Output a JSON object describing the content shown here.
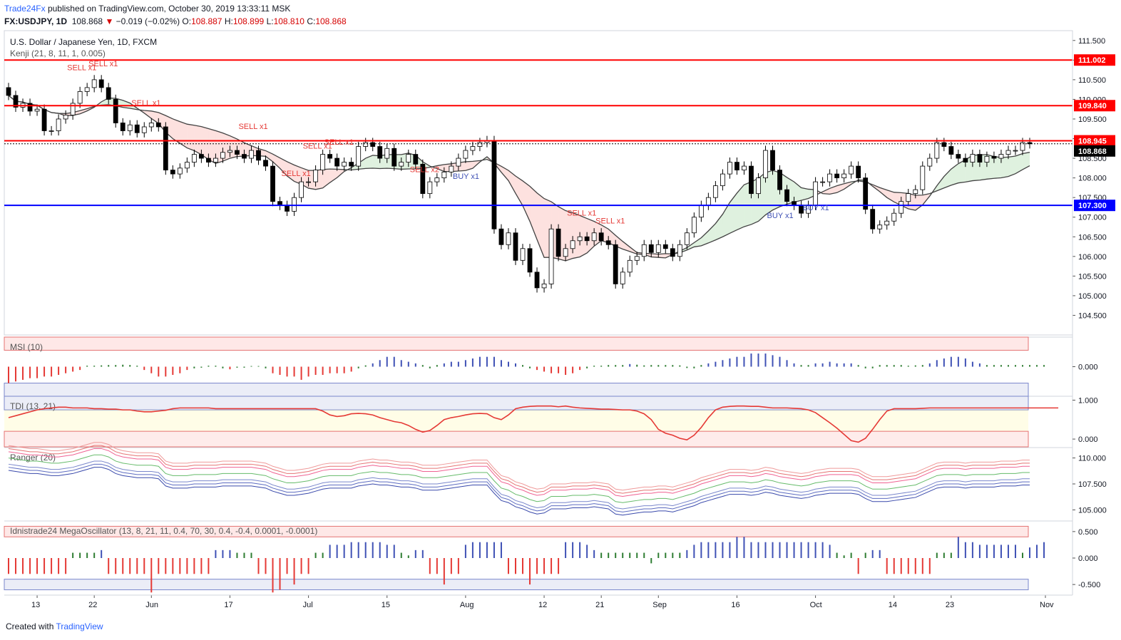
{
  "header": {
    "brand": "Trade24Fx",
    "published": "published on TradingView.com, October 30, 2019 13:33:11 MSK",
    "symbol": "FX:USDJPY, 1D",
    "last": "108.868",
    "change": "−0.019 (−0.02%)",
    "o_label": "O:",
    "o": "108.887",
    "h_label": "H:",
    "h": "108.899",
    "l_label": "L:",
    "l": "108.810",
    "c_label": "C:",
    "c": "108.868"
  },
  "footer": {
    "created": "Created with",
    "brand": "TradingView"
  },
  "colors": {
    "up": "#ffffff",
    "down": "#000000",
    "resistance": "#ff0000",
    "support": "#0000ff",
    "sell": "#e53935",
    "buy": "#3f51b5",
    "green": "#2e7d32"
  },
  "chart_data": [
    {
      "type": "candlestick",
      "title": "U.S. Dollar / Japanese Yen, 1D, FXCM",
      "indicator": "Kenji (21, 8, 11, 1, 0.005)",
      "ylim": [
        104.0,
        111.75
      ],
      "yticks": [
        "111.500",
        "111.000",
        "110.500",
        "110.000",
        "109.500",
        "109.000",
        "108.500",
        "108.000",
        "107.500",
        "107.000",
        "106.500",
        "106.000",
        "105.500",
        "105.000",
        "104.500"
      ],
      "xticks": [
        "13",
        "22",
        "Jun",
        "17",
        "Jul",
        "15",
        "Aug",
        "12",
        "21",
        "Sep",
        "16",
        "Oct",
        "14",
        "23",
        "Nov"
      ],
      "horizontal_lines": [
        {
          "label": "111.002",
          "value": 111.002,
          "color": "#ff0000"
        },
        {
          "label": "109.840",
          "value": 109.84,
          "color": "#ff0000"
        },
        {
          "label": "108.945",
          "value": 108.945,
          "color": "#ff0000"
        },
        {
          "label": "107.300",
          "value": 107.3,
          "color": "#0000ff"
        }
      ],
      "last_price": {
        "label": "108.868",
        "value": 108.868
      },
      "annotations": [
        "SELL x1",
        "SELL x1",
        "SELL x1",
        "SELL x1",
        "SELL x1",
        "SELL x1",
        "SELL x1",
        "SELL x2",
        "SELL x1",
        "SELL x1",
        "BUY x1",
        "BUY x1",
        "BUY x1"
      ],
      "closes": [
        110.1,
        109.8,
        109.9,
        109.7,
        109.75,
        109.2,
        109.2,
        109.5,
        109.6,
        109.9,
        110.2,
        110.3,
        110.5,
        110.3,
        110.0,
        109.4,
        109.2,
        109.35,
        109.15,
        109.3,
        109.4,
        109.3,
        108.2,
        108.1,
        108.25,
        108.4,
        108.6,
        108.5,
        108.4,
        108.5,
        108.65,
        108.7,
        108.6,
        108.5,
        108.7,
        108.45,
        108.3,
        107.4,
        107.3,
        107.15,
        107.5,
        107.9,
        107.9,
        108.2,
        108.6,
        108.5,
        108.3,
        108.4,
        108.3,
        108.8,
        108.9,
        108.8,
        108.5,
        108.75,
        108.3,
        108.4,
        108.6,
        108.35,
        107.6,
        107.9,
        108.0,
        108.15,
        108.3,
        108.5,
        108.7,
        108.8,
        108.9,
        108.95,
        106.7,
        106.3,
        106.6,
        105.9,
        106.2,
        105.6,
        105.2,
        105.3,
        106.7,
        106.0,
        106.2,
        106.4,
        106.5,
        106.4,
        106.6,
        106.4,
        106.3,
        105.3,
        105.6,
        105.9,
        106.0,
        106.3,
        106.1,
        106.3,
        106.2,
        106.0,
        106.3,
        106.6,
        107.0,
        107.3,
        107.5,
        107.8,
        108.1,
        108.4,
        108.2,
        108.3,
        107.6,
        108.0,
        108.7,
        108.2,
        107.7,
        107.4,
        107.3,
        107.1,
        107.3,
        107.9,
        107.9,
        108.1,
        108.0,
        108.1,
        108.3,
        108.0,
        107.2,
        106.7,
        106.8,
        106.9,
        107.1,
        107.4,
        107.6,
        107.7,
        108.3,
        108.5,
        108.9,
        108.8,
        108.6,
        108.5,
        108.4,
        108.6,
        108.4,
        108.55,
        108.5,
        108.6,
        108.7,
        108.7,
        108.9,
        108.868
      ],
      "series": [
        {
          "name": "Kenji fast",
          "color": "#424242"
        },
        {
          "name": "Kenji slow",
          "color": "#424242"
        }
      ]
    },
    {
      "type": "bar",
      "title": "MSI (10)",
      "yticks": [
        "0.000"
      ],
      "values": [
        -0.5,
        -0.45,
        -0.4,
        -0.35,
        -0.35,
        -0.3,
        -0.3,
        -0.25,
        -0.2,
        -0.15,
        -0.1,
        0.03,
        0.03,
        0.04,
        0.05,
        0.05,
        0.06,
        0.05,
        0.03,
        -0.1,
        -0.2,
        -0.3,
        -0.3,
        -0.25,
        -0.2,
        -0.1,
        -0.05,
        -0.03,
        0.03,
        0.03,
        -0.05,
        -0.08,
        -0.03,
        -0.03,
        0.02,
        0.02,
        -0.05,
        -0.2,
        -0.25,
        -0.3,
        -0.3,
        -0.4,
        -0.3,
        -0.25,
        -0.25,
        -0.2,
        -0.2,
        -0.2,
        -0.15,
        -0.05,
        0.04,
        0.1,
        0.2,
        0.3,
        0.3,
        0.2,
        0.15,
        0.1,
        0.05,
        -0.05,
        0.05,
        0.1,
        0.15,
        0.15,
        0.2,
        0.25,
        0.3,
        0.3,
        0.3,
        0.2,
        0.15,
        0.1,
        0.05,
        -0.05,
        -0.1,
        -0.15,
        -0.2,
        -0.2,
        -0.25,
        -0.2,
        -0.1,
        -0.05,
        0.03,
        0.03,
        0.05,
        0.05,
        0.05,
        0.08,
        0.06,
        0.04,
        0.05,
        0.05,
        0.05,
        0.05,
        0.04,
        -0.04,
        -0.05,
        0.05,
        0.1,
        0.15,
        0.2,
        0.25,
        0.3,
        0.3,
        0.4,
        0.4,
        0.4,
        0.35,
        0.3,
        0.2,
        0.1,
        0.05,
        0.05,
        0.1,
        0.1,
        0.15,
        0.1,
        0.1,
        0.1,
        0.05,
        -0.05,
        -0.05,
        0.05,
        0.05,
        0.05,
        0.05,
        0.03,
        0.04,
        0.05,
        0.1,
        0.2,
        0.25,
        0.3,
        0.3,
        0.25,
        0.15,
        0.1,
        0.05,
        0.05,
        0.05,
        0.05,
        0.05,
        0.05,
        0.05,
        0.05,
        0.05
      ]
    },
    {
      "type": "line",
      "title": "TDI (13, 21)",
      "yticks": [
        "1.000",
        "0.000"
      ],
      "values": [
        0.55,
        0.6,
        0.65,
        0.7,
        0.75,
        0.78,
        0.8,
        0.82,
        0.82,
        0.8,
        0.8,
        0.8,
        0.78,
        0.78,
        0.77,
        0.77,
        0.75,
        0.75,
        0.72,
        0.7,
        0.7,
        0.72,
        0.74,
        0.78,
        0.8,
        0.8,
        0.8,
        0.8,
        0.8,
        0.78,
        0.78,
        0.78,
        0.78,
        0.78,
        0.78,
        0.78,
        0.78,
        0.78,
        0.78,
        0.78,
        0.78,
        0.78,
        0.78,
        0.78,
        0.72,
        0.62,
        0.58,
        0.6,
        0.65,
        0.66,
        0.65,
        0.62,
        0.55,
        0.5,
        0.45,
        0.42,
        0.35,
        0.25,
        0.18,
        0.22,
        0.35,
        0.5,
        0.55,
        0.58,
        0.62,
        0.65,
        0.66,
        0.65,
        0.55,
        0.5,
        0.62,
        0.78,
        0.82,
        0.84,
        0.85,
        0.85,
        0.85,
        0.83,
        0.85,
        0.82,
        0.8,
        0.79,
        0.78,
        0.77,
        0.77,
        0.76,
        0.75,
        0.75,
        0.72,
        0.65,
        0.5,
        0.25,
        0.15,
        0.1,
        0.02,
        -0.02,
        0.1,
        0.3,
        0.55,
        0.75,
        0.82,
        0.84,
        0.85,
        0.85,
        0.84,
        0.84,
        0.82,
        0.8,
        0.8,
        0.8,
        0.79,
        0.78,
        0.75,
        0.68,
        0.55,
        0.42,
        0.28,
        0.12,
        -0.04,
        -0.08,
        0.02,
        0.25,
        0.5,
        0.72,
        0.78,
        0.78,
        0.78,
        0.78,
        0.79,
        0.8,
        0.8,
        0.8,
        0.8,
        0.8,
        0.8,
        0.8,
        0.8,
        0.8,
        0.8,
        0.8,
        0.8,
        0.8,
        0.8,
        0.8,
        0.8,
        0.8,
        0.8,
        0.8
      ]
    },
    {
      "type": "line",
      "title": "Ranger (20)",
      "yticks": [
        "110.000",
        "107.500",
        "105.000"
      ],
      "values": [
        110.0,
        109.9,
        109.8,
        109.7,
        109.7,
        109.6,
        109.5,
        109.5,
        109.6,
        109.7,
        109.9,
        110.1,
        110.3,
        110.3,
        110.1,
        109.7,
        109.5,
        109.4,
        109.3,
        109.3,
        109.3,
        109.2,
        108.5,
        108.3,
        108.3,
        108.3,
        108.4,
        108.4,
        108.4,
        108.4,
        108.5,
        108.5,
        108.5,
        108.5,
        108.5,
        108.4,
        108.3,
        108.0,
        107.8,
        107.6,
        107.6,
        107.7,
        107.8,
        108.0,
        108.2,
        108.3,
        108.3,
        108.3,
        108.3,
        108.5,
        108.6,
        108.7,
        108.6,
        108.6,
        108.5,
        108.4,
        108.4,
        108.3,
        108.1,
        108.1,
        108.1,
        108.2,
        108.3,
        108.4,
        108.5,
        108.6,
        108.6,
        108.6,
        107.8,
        107.1,
        106.9,
        106.5,
        106.3,
        106.0,
        105.8,
        105.9,
        106.3,
        106.3,
        106.3,
        106.4,
        106.4,
        106.4,
        106.5,
        106.4,
        106.3,
        105.8,
        105.7,
        105.8,
        105.9,
        106.0,
        106.0,
        106.1,
        106.1,
        106.0,
        106.2,
        106.4,
        106.6,
        106.9,
        107.1,
        107.3,
        107.5,
        107.7,
        107.7,
        107.7,
        107.6,
        107.7,
        107.9,
        107.8,
        107.6,
        107.5,
        107.4,
        107.3,
        107.4,
        107.6,
        107.7,
        107.8,
        107.8,
        107.8,
        107.8,
        107.7,
        107.3,
        107.0,
        107.0,
        107.0,
        107.1,
        107.2,
        107.3,
        107.4,
        107.7,
        108.0,
        108.3,
        108.4,
        108.4,
        108.4,
        108.3,
        108.4,
        108.4,
        108.4,
        108.4,
        108.5,
        108.5,
        108.5,
        108.6,
        108.6
      ]
    },
    {
      "type": "bar",
      "title": "Idnistrade24 MegaOscillator (13, 8, 21, 11, 0.4, 70, 30, 0.4, -0.4, 0.0001, -0.0001)",
      "yticks": [
        "0.500",
        "0.000",
        "-0.500"
      ],
      "values": [
        -0.3,
        -0.3,
        -0.3,
        -0.3,
        -0.3,
        -0.3,
        -0.3,
        -0.3,
        -0.3,
        0.1,
        0.1,
        0.1,
        0.1,
        0.15,
        -0.3,
        -0.3,
        -0.3,
        -0.3,
        -0.3,
        -0.3,
        -0.65,
        -0.3,
        -0.3,
        -0.3,
        -0.3,
        -0.3,
        -0.3,
        -0.3,
        -0.3,
        0.15,
        0.15,
        0.15,
        0.1,
        0.1,
        0.1,
        -0.3,
        -0.3,
        -0.65,
        -0.6,
        -0.3,
        -0.5,
        -0.3,
        -0.3,
        0.1,
        0.1,
        0.25,
        0.25,
        0.25,
        0.3,
        0.3,
        0.3,
        0.3,
        0.3,
        0.25,
        0.25,
        0.1,
        0.05,
        0.15,
        0.15,
        -0.3,
        -0.3,
        -0.5,
        -0.3,
        -0.3,
        0.25,
        0.3,
        0.3,
        0.3,
        0.3,
        0.3,
        -0.3,
        -0.3,
        -0.3,
        -0.5,
        -0.3,
        -0.3,
        -0.3,
        -0.3,
        0.3,
        0.3,
        0.3,
        0.25,
        0.15,
        0.1,
        0.1,
        0.1,
        0.1,
        0.1,
        0.1,
        0.1,
        -0.1,
        0.1,
        0.1,
        0.1,
        0.1,
        0.15,
        0.25,
        0.3,
        0.3,
        0.3,
        0.3,
        0.3,
        0.4,
        0.4,
        0.3,
        0.3,
        0.3,
        0.3,
        0.3,
        0.3,
        0.3,
        0.3,
        0.3,
        0.3,
        0.3,
        0.25,
        0.1,
        0.05,
        0.1,
        -0.3,
        0.1,
        0.15,
        0.15,
        -0.3,
        -0.3,
        -0.3,
        -0.3,
        -0.3,
        -0.3,
        -0.3,
        0.1,
        0.1,
        0.1,
        0.4,
        0.3,
        0.3,
        0.25,
        0.25,
        0.25,
        0.25,
        0.25,
        0.25,
        0.1,
        0.2,
        0.25,
        0.3
      ]
    }
  ]
}
